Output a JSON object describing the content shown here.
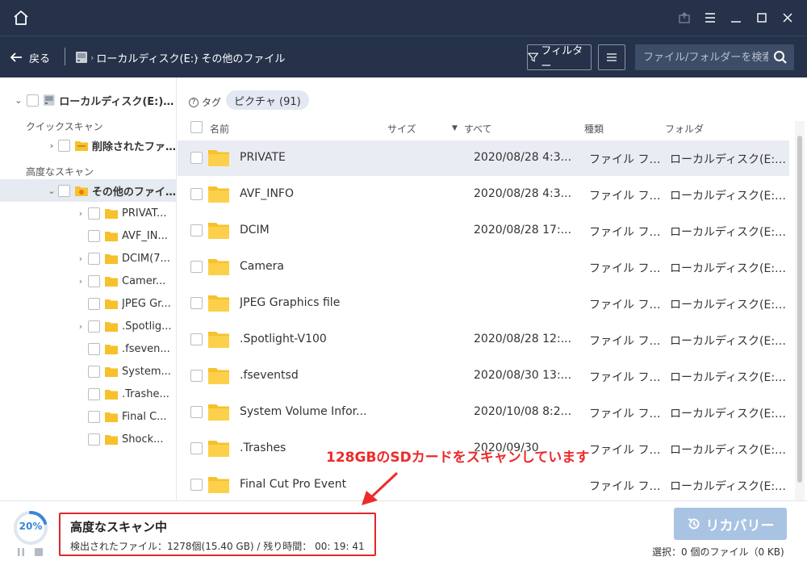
{
  "titlebar": {
    "icons": [
      "home-icon",
      "feedback-icon",
      "menu-icon",
      "minimize-icon",
      "maximize-icon",
      "close-icon"
    ]
  },
  "navbar": {
    "back_label": "戻る",
    "breadcrumb": [
      "ローカルディスク(E:)",
      "その他のファイル"
    ],
    "filter_label": "フィルター",
    "search_placeholder": "ファイル/フォルダーを検索"
  },
  "sidebar": {
    "root_label": "ローカルディスク(E:)(...",
    "quick_scan_label": "クイックスキャン",
    "deleted_files_label": "削除されたファ...",
    "advanced_scan_label": "高度なスキャン",
    "other_files_label": "その他のファイ...",
    "items": [
      {
        "label": "PRIVAT...",
        "expandable": true
      },
      {
        "label": "AVF_IN...",
        "expandable": false
      },
      {
        "label": "DCIM(7...",
        "expandable": true
      },
      {
        "label": "Camer...",
        "expandable": true
      },
      {
        "label": "JPEG Gr...",
        "expandable": false
      },
      {
        "label": ".Spotlig...",
        "expandable": true
      },
      {
        "label": ".fseven...",
        "expandable": false
      },
      {
        "label": "System...",
        "expandable": false
      },
      {
        "label": ".Trashe...",
        "expandable": false
      },
      {
        "label": "Final C...",
        "expandable": false
      },
      {
        "label": "Shock...",
        "expandable": false
      }
    ]
  },
  "main": {
    "tag_label": "タグ",
    "tag_pill": "ピクチャ (91)",
    "columns": {
      "name": "名前",
      "size": "サイズ",
      "date": "すべて",
      "type": "種類",
      "folder": "フォルダ"
    },
    "rows": [
      {
        "name": "PRIVATE",
        "date": "2020/08/28 4:3...",
        "type": "ファイル フォ...",
        "folder": "ローカルディスク(E:)¥..."
      },
      {
        "name": "AVF_INFO",
        "date": "2020/08/28 4:3...",
        "type": "ファイル フォ...",
        "folder": "ローカルディスク(E:)¥..."
      },
      {
        "name": "DCIM",
        "date": "2020/08/28 17:...",
        "type": "ファイル フォ...",
        "folder": "ローカルディスク(E:)¥..."
      },
      {
        "name": "Camera",
        "date": "",
        "type": "ファイル フォ...",
        "folder": "ローカルディスク(E:)¥..."
      },
      {
        "name": "JPEG Graphics file",
        "date": "",
        "type": "ファイル フォ...",
        "folder": "ローカルディスク(E:)¥..."
      },
      {
        "name": ".Spotlight-V100",
        "date": "2020/08/28 12:...",
        "type": "ファイル フォ...",
        "folder": "ローカルディスク(E:)¥..."
      },
      {
        "name": ".fseventsd",
        "date": "2020/08/30 13:...",
        "type": "ファイル フォ...",
        "folder": "ローカルディスク(E:)¥..."
      },
      {
        "name": "System Volume Infor...",
        "date": "2020/10/08 8:2...",
        "type": "ファイル フォ...",
        "folder": "ローカルディスク(E:)¥..."
      },
      {
        "name": ".Trashes",
        "date": "2020/09/30",
        "type": "ファイル フォ...",
        "folder": "ローカルディスク(E:)¥..."
      },
      {
        "name": "Final Cut Pro Event",
        "date": "",
        "type": "ファイル フォ...",
        "folder": "ローカルディスク(E:)¥..."
      }
    ]
  },
  "bottom": {
    "progress_percent": 20,
    "progress_label": "20%",
    "status_title": "高度なスキャン中",
    "status_detail": "検出されたファイル：1278個(15.40 GB) / 残り時間： 00: 19: 41",
    "recover_label": "リカバリー",
    "selected_info": "選択：0 個のファイル（0 KB)"
  },
  "annotation": {
    "text": "128GBのSDカードをスキャンしています"
  },
  "colors": {
    "titlebar_bg": "#25324a",
    "folder_yellow": "#f6c12b",
    "accent_blue": "#3a86d8",
    "annotation_red": "#e0282b",
    "recover_btn_bg": "#a9c3e3"
  }
}
